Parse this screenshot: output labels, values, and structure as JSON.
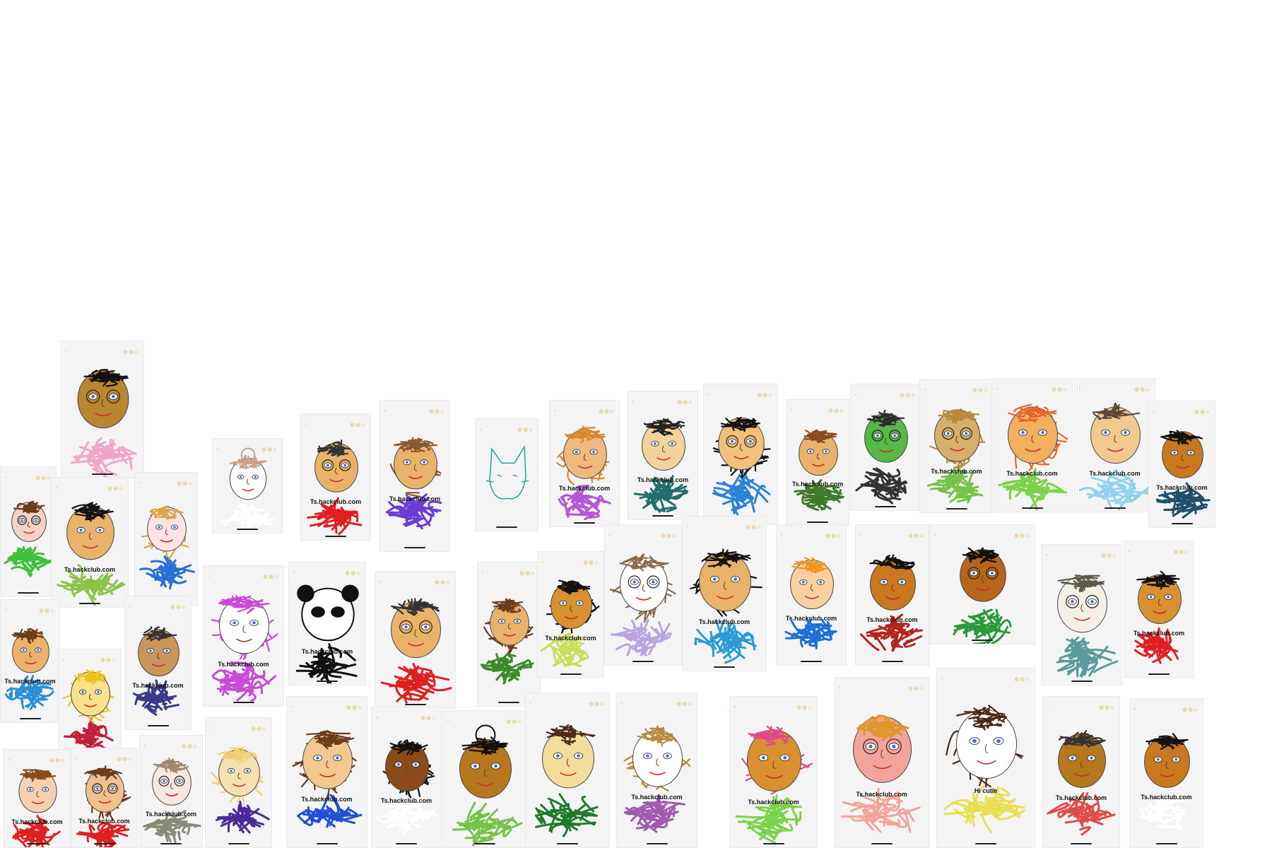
{
  "page": {
    "background": "#ffffff"
  },
  "caption_text": "Ts.hackclub.com",
  "cards": [
    {
      "name": "card-dark-hair-pink-shirt",
      "skin": "#b8862f",
      "hair": "#111111",
      "hairStyle": "messy",
      "shirt": "#f2a4c8",
      "cap": "",
      "glasses": true
    },
    {
      "name": "card-teal-glasses-green",
      "skin": "#f3d3c6",
      "hair": "#6b3b1a",
      "hairStyle": "short",
      "shirt": "#3fbf3a",
      "cap": "",
      "glasses": true
    },
    {
      "name": "card-black-hair-green",
      "skin": "#e9b26a",
      "hair": "#111111",
      "hairStyle": "messy",
      "shirt": "#8bc34a",
      "cap": "Ts.hackclub.com",
      "glasses": false
    },
    {
      "name": "card-fox-ears-blue",
      "skin": "#fde3e3",
      "hair": "#d7a64b",
      "hairStyle": "long",
      "shirt": "#2a6fd6",
      "cap": "",
      "glasses": false
    },
    {
      "name": "card-bun-sketch",
      "skin": "#ffffff",
      "hair": "#c9a089",
      "hairStyle": "bun",
      "shirt": "#ffffff",
      "cap": "",
      "glasses": false
    },
    {
      "name": "card-red-cross-shirt",
      "skin": "#e9b26a",
      "hair": "#333333",
      "hairStyle": "short",
      "shirt": "#e02020",
      "cap": "Ts.hackclub.com",
      "glasses": true
    },
    {
      "name": "card-curly-purple",
      "skin": "#e9b26a",
      "hair": "#8a5a2b",
      "hairStyle": "curly",
      "shirt": "#6a3bd6",
      "cap": "Ts.hackclub.com",
      "glasses": false
    },
    {
      "name": "card-cat-outline",
      "skin": "#ffffff",
      "hair": "#18a89a",
      "hairStyle": "cat",
      "shirt": "#ffffff",
      "cap": "",
      "glasses": false
    },
    {
      "name": "card-orange-hair-violet",
      "skin": "#f0b980",
      "hair": "#d9862c",
      "hairStyle": "curly",
      "shirt": "#b455d6",
      "cap": "Ts.hackclub.com",
      "glasses": false
    },
    {
      "name": "card-teal-shirt",
      "skin": "#f1d39b",
      "hair": "#222222",
      "hairStyle": "short",
      "shirt": "#1f6f6a",
      "cap": "Ts.hackclub.com",
      "glasses": false
    },
    {
      "name": "card-black-bob-blue",
      "skin": "#f1c07a",
      "hair": "#111111",
      "hairStyle": "bob",
      "shirt": "#2a82d6",
      "cap": "",
      "glasses": true
    },
    {
      "name": "card-brown-hair-green",
      "skin": "#e9b26a",
      "hair": "#8a4a1a",
      "hairStyle": "short",
      "shirt": "#3d7a2a",
      "cap": "Ts.hackclub.com",
      "glasses": false
    },
    {
      "name": "card-monster-purple",
      "skin": "#56b847",
      "hair": "#2c2c2c",
      "hairStyle": "spiky",
      "shirt": "#333333",
      "cap": "",
      "glasses": true
    },
    {
      "name": "card-long-blonde-glasses",
      "skin": "#d6b06a",
      "hair": "#b98a3a",
      "hairStyle": "long",
      "shirt": "#76c34a",
      "cap": "Ts.hackclub.com",
      "glasses": true
    },
    {
      "name": "card-ginger-green",
      "skin": "#f0b060",
      "hair": "#e8622a",
      "hairStyle": "long",
      "shirt": "#7cd24a",
      "cap": "Ts.hackclub.com",
      "glasses": false
    },
    {
      "name": "card-brown-hair-lightblue",
      "skin": "#f1c890",
      "hair": "#5a4a3a",
      "hairStyle": "short",
      "shirt": "#8fd3f0",
      "cap": "Ts.hackclub.com",
      "glasses": false
    },
    {
      "name": "card-dark-skin-navy",
      "skin": "#c8781f",
      "hair": "#111111",
      "hairStyle": "messy",
      "shirt": "#1f4f6a",
      "cap": "Ts.hackclub.com",
      "glasses": false
    },
    {
      "name": "card-brown-hair-blue",
      "skin": "#e9b26a",
      "hair": "#6b3b1a",
      "hairStyle": "short",
      "shirt": "#2a8fd6",
      "cap": "Ts.hackclub.com",
      "glasses": false
    },
    {
      "name": "card-striped-shirt",
      "skin": "#fde08a",
      "hair": "#f0c020",
      "hairStyle": "curly",
      "shirt": "#c01f3a",
      "cap": "",
      "glasses": false
    },
    {
      "name": "card-cat-ears-navy",
      "skin": "#c8965a",
      "hair": "#333333",
      "hairStyle": "spiky",
      "shirt": "#3a3a8a",
      "cap": "Ts.hackclub.com",
      "glasses": false
    },
    {
      "name": "card-octopus-pink",
      "skin": "#ffffff",
      "hair": "#c74bd6",
      "hairStyle": "octopus",
      "shirt": "#c74bd6",
      "cap": "Ts.hackclub.com",
      "glasses": false
    },
    {
      "name": "card-panda",
      "skin": "#ffffff",
      "hair": "#111111",
      "hairStyle": "panda",
      "shirt": "#111111",
      "cap": "Ts.hackclub.com",
      "glasses": false
    },
    {
      "name": "card-red-cross-glasses",
      "skin": "#e9b26a",
      "hair": "#333333",
      "hairStyle": "short",
      "shirt": "#e02020",
      "cap": "",
      "glasses": true
    },
    {
      "name": "card-brown-hair-green-scarf",
      "skin": "#e9b26a",
      "hair": "#6b3b1a",
      "hairStyle": "long",
      "shirt": "#3d8a2a",
      "cap": "",
      "glasses": false
    },
    {
      "name": "card-curly-lime",
      "skin": "#d99030",
      "hair": "#111111",
      "hairStyle": "curly",
      "shirt": "#c6e05a",
      "cap": "Ts.hackclub.com",
      "glasses": false
    },
    {
      "name": "card-curly-white-dress",
      "skin": "#ffffff",
      "hair": "#8a6a4a",
      "hairStyle": "curly",
      "shirt": "#b9a4e0",
      "cap": "",
      "glasses": true
    },
    {
      "name": "card-red-hood",
      "skin": "#e9b26a",
      "hair": "#111111",
      "hairStyle": "hood",
      "shirt": "#2a9ad6",
      "cap": "Ts.hackclub.com",
      "glasses": false
    },
    {
      "name": "card-orange-hair-blue",
      "skin": "#fbd0a0",
      "hair": "#f0961f",
      "hairStyle": "short",
      "shirt": "#1f6fd6",
      "cap": "Ts.hackclub.com",
      "glasses": false
    },
    {
      "name": "card-fish-hat",
      "skin": "#c8781f",
      "hair": "#111111",
      "hairStyle": "messy",
      "shirt": "#b3241f",
      "cap": "Ts.hackclub.com",
      "glasses": false
    },
    {
      "name": "card-dark-glasses-green",
      "skin": "#b5661a",
      "hair": "#111111",
      "hairStyle": "short",
      "shirt": "#2a9a3a",
      "cap": "",
      "glasses": true
    },
    {
      "name": "card-grey-teal",
      "skin": "#f4f0e8",
      "hair": "#5a5a4a",
      "hairStyle": "short",
      "shirt": "#5a9a9a",
      "cap": "",
      "glasses": true
    },
    {
      "name": "card-curly-red",
      "skin": "#d99030",
      "hair": "#111111",
      "hairStyle": "messy",
      "shirt": "#e02020",
      "cap": "Ts.hackclub.com",
      "glasses": false
    },
    {
      "name": "card-brown-kid-red",
      "skin": "#f6d0b0",
      "hair": "#8a4a1a",
      "hairStyle": "short",
      "shirt": "#e02020",
      "cap": "Ts.hackclub.com",
      "glasses": false
    },
    {
      "name": "card-glasses-red",
      "skin": "#f0c090",
      "hair": "#6b3b1a",
      "hairStyle": "long",
      "shirt": "#e02020",
      "cap": "Ts.hackclub.com",
      "glasses": true
    },
    {
      "name": "card-pale-grey",
      "skin": "#f6e8e0",
      "hair": "#a08a6a",
      "hairStyle": "short",
      "shirt": "#8a8a7a",
      "cap": "Ts.hackclub.com",
      "glasses": true
    },
    {
      "name": "card-blonde-purple",
      "skin": "#f4e0b0",
      "hair": "#f0d070",
      "hairStyle": "bob",
      "shirt": "#4a2a9a",
      "cap": "",
      "glasses": false
    },
    {
      "name": "card-long-brown-blue",
      "skin": "#f0c890",
      "hair": "#6b3b1a",
      "hairStyle": "long",
      "shirt": "#1f4fd6",
      "cap": "Ts.hackclub.com",
      "glasses": false
    },
    {
      "name": "card-braids-white",
      "skin": "#8a4a1a",
      "hair": "#111111",
      "hairStyle": "long",
      "shirt": "#ffffff",
      "cap": "Ts.hackclub.com",
      "glasses": false
    },
    {
      "name": "card-bun-green",
      "skin": "#b5781f",
      "hair": "#111111",
      "hairStyle": "bun",
      "shirt": "#76c34a",
      "cap": "",
      "glasses": false
    },
    {
      "name": "card-green-hoodie",
      "skin": "#f4dc9a",
      "hair": "#4a2a1a",
      "hairStyle": "messy",
      "shirt": "#1f7a2a",
      "cap": "",
      "glasses": false
    },
    {
      "name": "card-pale-skirt",
      "skin": "#ffffff",
      "hair": "#b98a3a",
      "hairStyle": "long",
      "shirt": "#a05ab0",
      "cap": "Ts.hackclub.com",
      "glasses": false
    },
    {
      "name": "card-headphones-pink",
      "skin": "#d99030",
      "hair": "#e04a8a",
      "hairStyle": "hood",
      "shirt": "#7cd24a",
      "cap": "Ts.hackclub.com",
      "glasses": false
    },
    {
      "name": "card-beanie-sunglasses",
      "skin": "#f2a49a",
      "hair": "#e0962a",
      "hairStyle": "beanie",
      "shirt": "#f2a49a",
      "cap": "Ts.hackclub.com",
      "glasses": true
    },
    {
      "name": "card-hi-cutie",
      "skin": "#ffffff",
      "hair": "#4a2a1a",
      "hairStyle": "long",
      "shirt": "#e8e050",
      "cap": "Hi cutie",
      "glasses": false
    },
    {
      "name": "card-red-shirt-kid",
      "skin": "#b5781f",
      "hair": "#333333",
      "hairStyle": "short",
      "shirt": "#e04a4a",
      "cap": "Ts.hackclub.com",
      "glasses": false
    },
    {
      "name": "card-curly-black-red",
      "skin": "#c8781f",
      "hair": "#111111",
      "hairStyle": "messy",
      "shirt": "#ffffff",
      "cap": "Ts.hackclub.com",
      "glasses": false
    }
  ]
}
